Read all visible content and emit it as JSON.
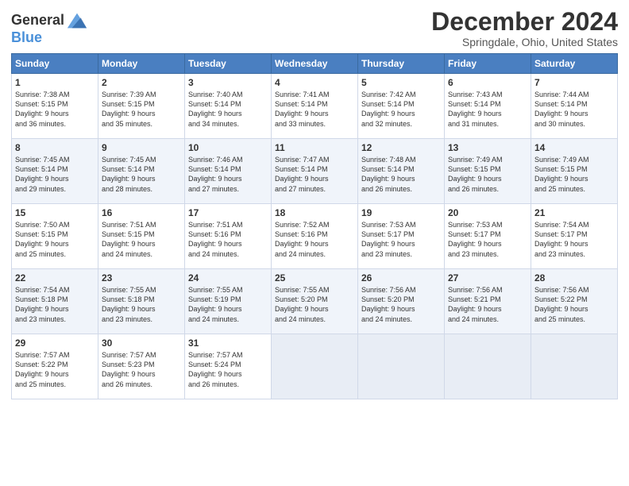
{
  "logo": {
    "line1": "General",
    "line2": "Blue"
  },
  "title": "December 2024",
  "subtitle": "Springdale, Ohio, United States",
  "days_of_week": [
    "Sunday",
    "Monday",
    "Tuesday",
    "Wednesday",
    "Thursday",
    "Friday",
    "Saturday"
  ],
  "weeks": [
    [
      {
        "day": "1",
        "info": "Sunrise: 7:38 AM\nSunset: 5:15 PM\nDaylight: 9 hours\nand 36 minutes."
      },
      {
        "day": "2",
        "info": "Sunrise: 7:39 AM\nSunset: 5:15 PM\nDaylight: 9 hours\nand 35 minutes."
      },
      {
        "day": "3",
        "info": "Sunrise: 7:40 AM\nSunset: 5:14 PM\nDaylight: 9 hours\nand 34 minutes."
      },
      {
        "day": "4",
        "info": "Sunrise: 7:41 AM\nSunset: 5:14 PM\nDaylight: 9 hours\nand 33 minutes."
      },
      {
        "day": "5",
        "info": "Sunrise: 7:42 AM\nSunset: 5:14 PM\nDaylight: 9 hours\nand 32 minutes."
      },
      {
        "day": "6",
        "info": "Sunrise: 7:43 AM\nSunset: 5:14 PM\nDaylight: 9 hours\nand 31 minutes."
      },
      {
        "day": "7",
        "info": "Sunrise: 7:44 AM\nSunset: 5:14 PM\nDaylight: 9 hours\nand 30 minutes."
      }
    ],
    [
      {
        "day": "8",
        "info": "Sunrise: 7:45 AM\nSunset: 5:14 PM\nDaylight: 9 hours\nand 29 minutes."
      },
      {
        "day": "9",
        "info": "Sunrise: 7:45 AM\nSunset: 5:14 PM\nDaylight: 9 hours\nand 28 minutes."
      },
      {
        "day": "10",
        "info": "Sunrise: 7:46 AM\nSunset: 5:14 PM\nDaylight: 9 hours\nand 27 minutes."
      },
      {
        "day": "11",
        "info": "Sunrise: 7:47 AM\nSunset: 5:14 PM\nDaylight: 9 hours\nand 27 minutes."
      },
      {
        "day": "12",
        "info": "Sunrise: 7:48 AM\nSunset: 5:14 PM\nDaylight: 9 hours\nand 26 minutes."
      },
      {
        "day": "13",
        "info": "Sunrise: 7:49 AM\nSunset: 5:15 PM\nDaylight: 9 hours\nand 26 minutes."
      },
      {
        "day": "14",
        "info": "Sunrise: 7:49 AM\nSunset: 5:15 PM\nDaylight: 9 hours\nand 25 minutes."
      }
    ],
    [
      {
        "day": "15",
        "info": "Sunrise: 7:50 AM\nSunset: 5:15 PM\nDaylight: 9 hours\nand 25 minutes."
      },
      {
        "day": "16",
        "info": "Sunrise: 7:51 AM\nSunset: 5:15 PM\nDaylight: 9 hours\nand 24 minutes."
      },
      {
        "day": "17",
        "info": "Sunrise: 7:51 AM\nSunset: 5:16 PM\nDaylight: 9 hours\nand 24 minutes."
      },
      {
        "day": "18",
        "info": "Sunrise: 7:52 AM\nSunset: 5:16 PM\nDaylight: 9 hours\nand 24 minutes."
      },
      {
        "day": "19",
        "info": "Sunrise: 7:53 AM\nSunset: 5:17 PM\nDaylight: 9 hours\nand 23 minutes."
      },
      {
        "day": "20",
        "info": "Sunrise: 7:53 AM\nSunset: 5:17 PM\nDaylight: 9 hours\nand 23 minutes."
      },
      {
        "day": "21",
        "info": "Sunrise: 7:54 AM\nSunset: 5:17 PM\nDaylight: 9 hours\nand 23 minutes."
      }
    ],
    [
      {
        "day": "22",
        "info": "Sunrise: 7:54 AM\nSunset: 5:18 PM\nDaylight: 9 hours\nand 23 minutes."
      },
      {
        "day": "23",
        "info": "Sunrise: 7:55 AM\nSunset: 5:18 PM\nDaylight: 9 hours\nand 23 minutes."
      },
      {
        "day": "24",
        "info": "Sunrise: 7:55 AM\nSunset: 5:19 PM\nDaylight: 9 hours\nand 24 minutes."
      },
      {
        "day": "25",
        "info": "Sunrise: 7:55 AM\nSunset: 5:20 PM\nDaylight: 9 hours\nand 24 minutes."
      },
      {
        "day": "26",
        "info": "Sunrise: 7:56 AM\nSunset: 5:20 PM\nDaylight: 9 hours\nand 24 minutes."
      },
      {
        "day": "27",
        "info": "Sunrise: 7:56 AM\nSunset: 5:21 PM\nDaylight: 9 hours\nand 24 minutes."
      },
      {
        "day": "28",
        "info": "Sunrise: 7:56 AM\nSunset: 5:22 PM\nDaylight: 9 hours\nand 25 minutes."
      }
    ],
    [
      {
        "day": "29",
        "info": "Sunrise: 7:57 AM\nSunset: 5:22 PM\nDaylight: 9 hours\nand 25 minutes."
      },
      {
        "day": "30",
        "info": "Sunrise: 7:57 AM\nSunset: 5:23 PM\nDaylight: 9 hours\nand 26 minutes."
      },
      {
        "day": "31",
        "info": "Sunrise: 7:57 AM\nSunset: 5:24 PM\nDaylight: 9 hours\nand 26 minutes."
      },
      null,
      null,
      null,
      null
    ]
  ]
}
